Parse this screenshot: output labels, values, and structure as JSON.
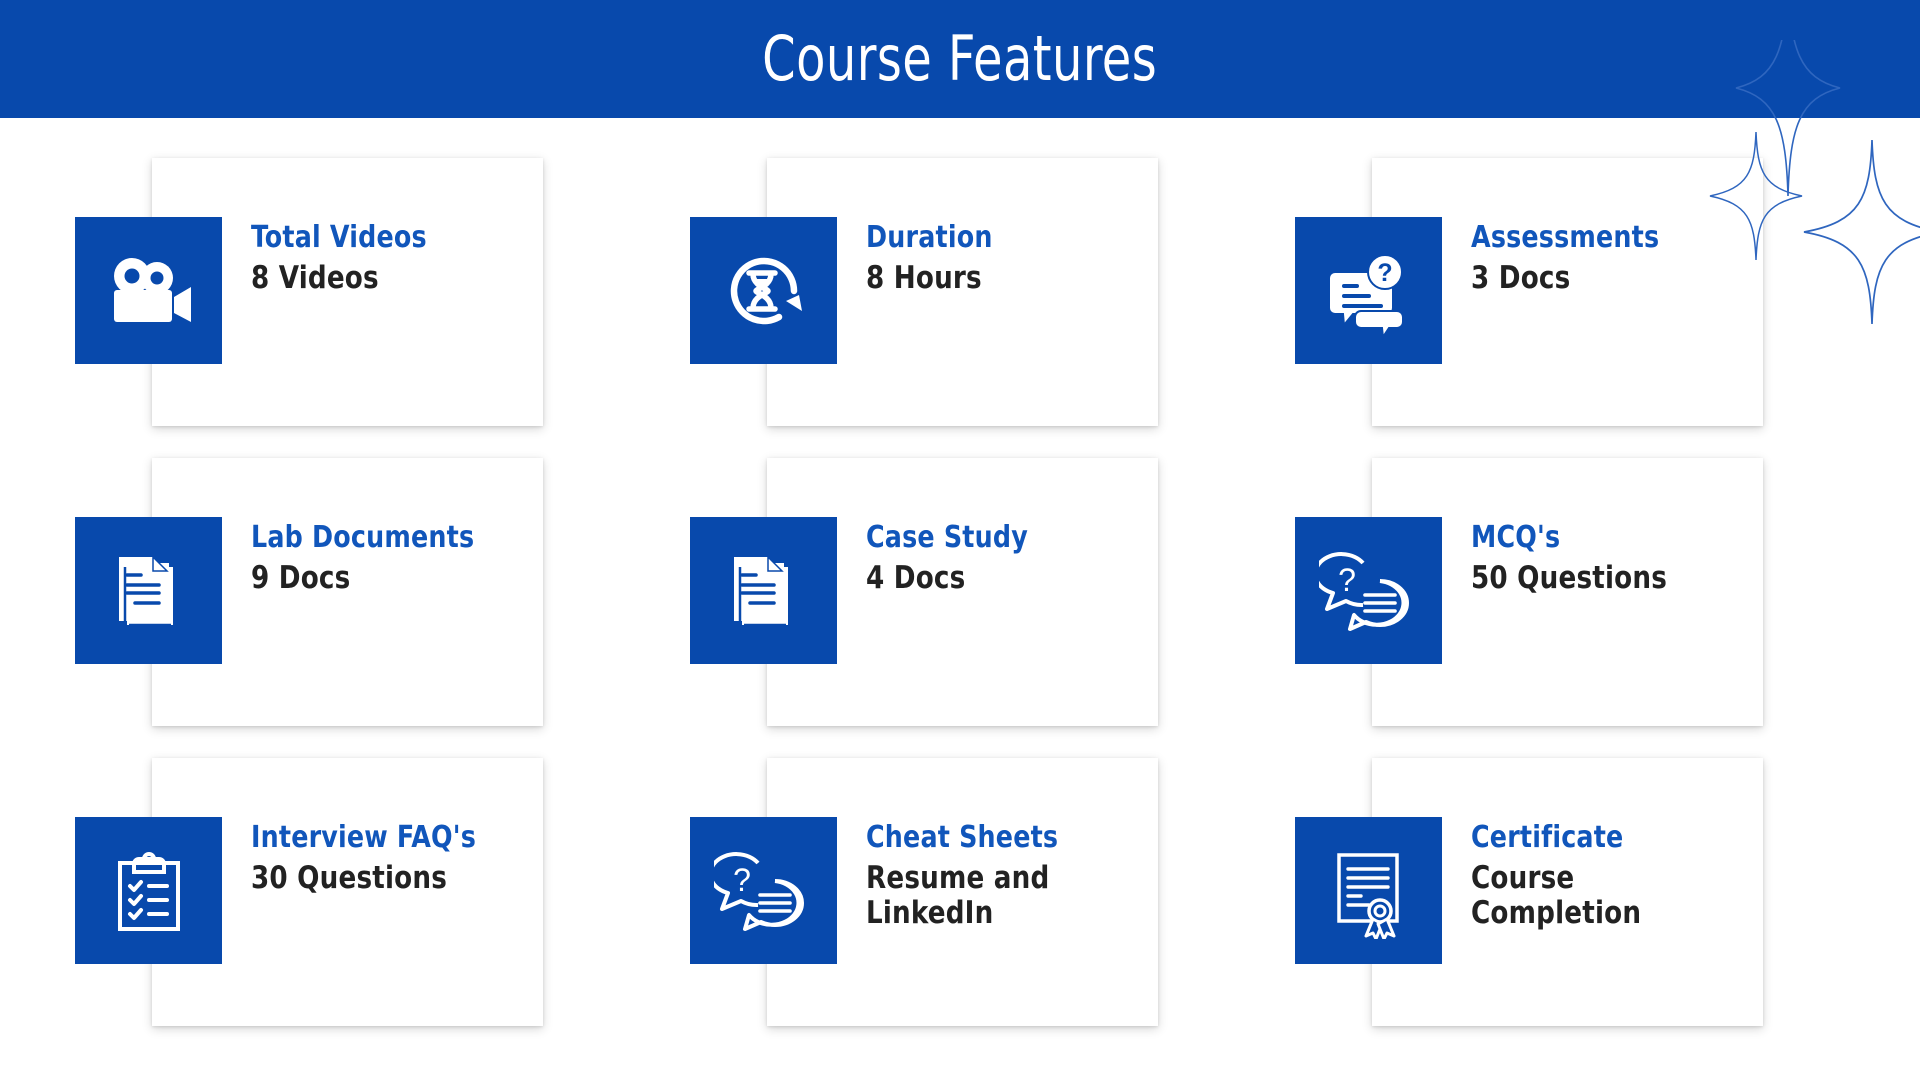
{
  "header": {
    "title": "Course Features",
    "bg_color": "#0849ac",
    "text_color": "#ffffff"
  },
  "theme": {
    "accent_blue": "#0849ac",
    "title_blue": "#1156bb",
    "value_dark": "#222222",
    "card_bg": "#ffffff",
    "page_bg": "#ffffff"
  },
  "decor": {
    "sparkle_color": "#2f66bf",
    "sparkle_count": 3
  },
  "cards": [
    {
      "icon": "video-camera-icon",
      "title": "Total Videos",
      "value": "8 Videos"
    },
    {
      "icon": "hourglass-refresh-icon",
      "title": "Duration",
      "value": "8 Hours"
    },
    {
      "icon": "assessment-chat-question-icon",
      "title": "Assessments",
      "value": "3 Docs"
    },
    {
      "icon": "documents-stack-icon",
      "title": "Lab Documents",
      "value": "9 Docs"
    },
    {
      "icon": "documents-stack-icon",
      "title": "Case Study",
      "value": "4 Docs"
    },
    {
      "icon": "chat-bubbles-question-icon",
      "title": "MCQ's",
      "value": "50 Questions"
    },
    {
      "icon": "clipboard-checklist-icon",
      "title": "Interview FAQ's",
      "value": "30 Questions"
    },
    {
      "icon": "chat-bubbles-question-icon",
      "title": "Cheat Sheets",
      "value": "Resume and\nLinkedIn"
    },
    {
      "icon": "certificate-ribbon-icon",
      "title": "Certificate",
      "value": "Course Completion"
    }
  ]
}
